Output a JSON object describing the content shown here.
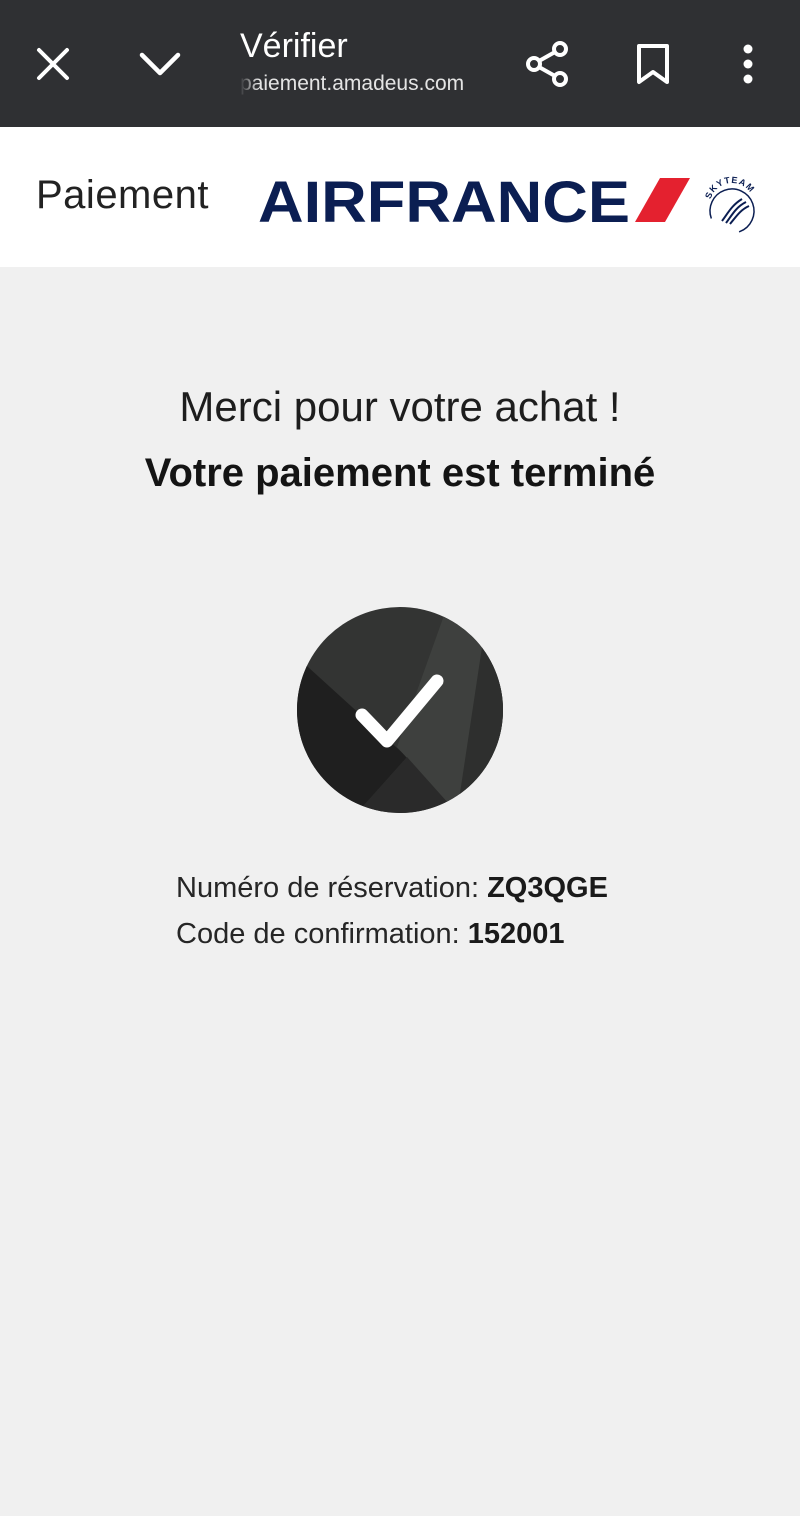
{
  "browser": {
    "title": "Vérifier",
    "url": "paiement.amadeus.com",
    "icons": [
      "close-icon",
      "chevron-down-icon",
      "share-icon",
      "bookmark-icon",
      "more-vert-icon"
    ]
  },
  "header": {
    "title": "Paiement",
    "brand": "AIRFRANCE",
    "alliance": "SKYTEAM"
  },
  "confirmation": {
    "thanks_message": "Merci pour votre achat !",
    "status_message": "Votre paiement est terminé",
    "icon": "check-icon",
    "booking_label": "Numéro de réservation:",
    "booking_value": "ZQ3QGE",
    "code_label": "Code de confirmation:",
    "code_value": "152001"
  },
  "colors": {
    "toolbar_bg": "#2f3033",
    "page_bg": "#f0f0f0",
    "brand_navy": "#0b1e52",
    "brand_red": "#e4212f"
  }
}
